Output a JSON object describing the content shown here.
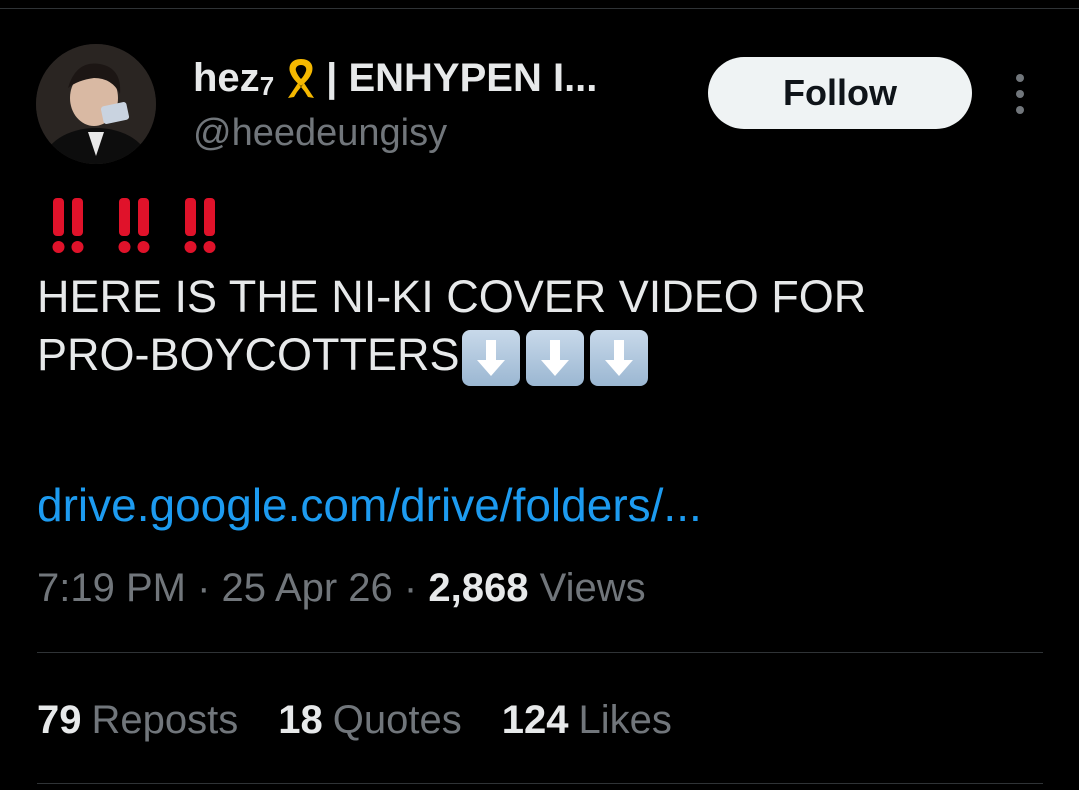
{
  "author": {
    "display_name": "hez",
    "display_name_sub": "7",
    "display_name_rest": "| ENHYPEN I...",
    "handle": "@heedeungisy",
    "ribbon_icon": "yellow-ribbon-icon",
    "ribbon_color": "#f5b800"
  },
  "follow_button": {
    "label": "Follow"
  },
  "more_icon": "more-vertical-icon",
  "tweet": {
    "exclaim_icon": "double-exclamation-icon",
    "exclaim_color": "#e0122a",
    "text_line_1": "HERE IS THE NI-KI COVER VIDEO FOR",
    "text_line_2": "PRO-BOYCOTTERS",
    "arrow_icon": "down-arrow-icon",
    "link_text": "drive.google.com/drive/folders/..."
  },
  "meta": {
    "time": "7:19 PM",
    "separator": "·",
    "date": "25 Apr 26",
    "views_count": "2,868",
    "views_label": "Views"
  },
  "stats": [
    {
      "count": "79",
      "label": "Reposts"
    },
    {
      "count": "18",
      "label": "Quotes"
    },
    {
      "count": "124",
      "label": "Likes"
    }
  ],
  "colors": {
    "background": "#000000",
    "link": "#1d9bf0",
    "secondary_text": "#71767b",
    "primary_text": "#e7e9ea"
  }
}
